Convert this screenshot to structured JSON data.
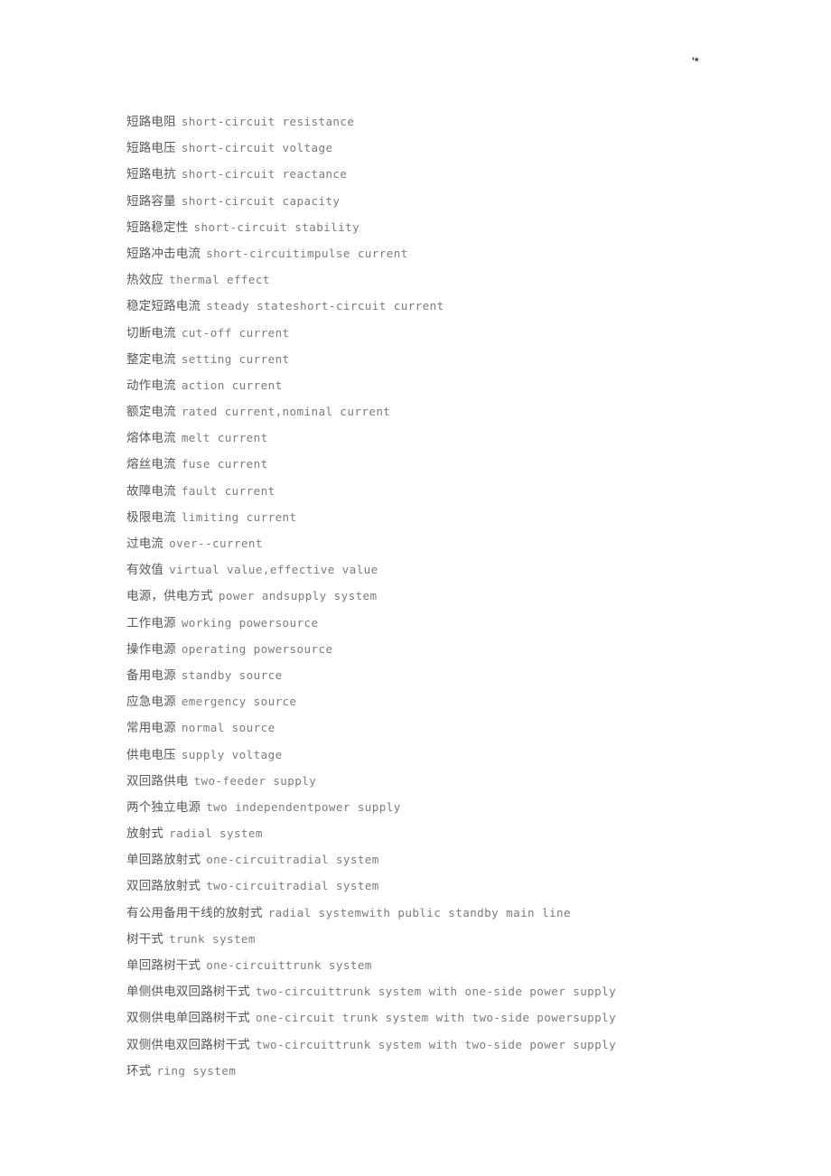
{
  "page": {
    "corner_mark": "'*"
  },
  "glossary": {
    "entries": [
      {
        "zh": "短路电阻",
        "en": "short-circuit resistance"
      },
      {
        "zh": "短路电压",
        "en": "short-circuit voltage"
      },
      {
        "zh": "短路电抗",
        "en": "short-circuit reactance"
      },
      {
        "zh": "短路容量",
        "en": "short-circuit capacity"
      },
      {
        "zh": "短路稳定性",
        "en": "short-circuit stability"
      },
      {
        "zh": "短路冲击电流",
        "en": "short-circuitimpulse current"
      },
      {
        "zh": "热效应",
        "en": "thermal effect"
      },
      {
        "zh": "稳定短路电流",
        "en": "steady stateshort-circuit current"
      },
      {
        "zh": "切断电流",
        "en": "cut-off current"
      },
      {
        "zh": "整定电流",
        "en": "setting current"
      },
      {
        "zh": "动作电流",
        "en": "action current"
      },
      {
        "zh": "额定电流",
        "en": "rated current,nominal current"
      },
      {
        "zh": "熔体电流",
        "en": "melt current"
      },
      {
        "zh": "熔丝电流",
        "en": "fuse current"
      },
      {
        "zh": "故障电流",
        "en": "fault current"
      },
      {
        "zh": "极限电流",
        "en": "limiting current"
      },
      {
        "zh": "过电流",
        "en": "over--current"
      },
      {
        "zh": "有效值",
        "en": "virtual value,effective value"
      },
      {
        "zh": "电源，供电方式",
        "en": "power andsupply system"
      },
      {
        "zh": "工作电源",
        "en": "working powersource"
      },
      {
        "zh": "操作电源",
        "en": "operating powersource"
      },
      {
        "zh": "备用电源",
        "en": "standby source"
      },
      {
        "zh": "应急电源",
        "en": "emergency source"
      },
      {
        "zh": "常用电源",
        "en": "normal source"
      },
      {
        "zh": "供电电压",
        "en": "supply voltage"
      },
      {
        "zh": "双回路供电",
        "en": "two-feeder supply"
      },
      {
        "zh": "两个独立电源",
        "en": "two independentpower supply"
      },
      {
        "zh": "放射式",
        "en": "radial system"
      },
      {
        "zh": "单回路放射式",
        "en": "one-circuitradial system"
      },
      {
        "zh": "双回路放射式",
        "en": "two-circuitradial system"
      },
      {
        "zh": "有公用备用干线的放射式",
        "en": "radial systemwith public standby main line"
      },
      {
        "zh": "树干式",
        "en": "trunk system"
      },
      {
        "zh": "单回路树干式",
        "en": "one-circuittrunk system"
      },
      {
        "zh": "单侧供电双回路树干式",
        "en": "two-circuittrunk system with one-side power supply"
      },
      {
        "zh": "双侧供电单回路树干式",
        "en": "one-circuit trunk system with two-side powersupply"
      },
      {
        "zh": "双侧供电双回路树干式",
        "en": "two-circuittrunk system with two-side power supply"
      },
      {
        "zh": "环式",
        "en": "ring system"
      }
    ]
  }
}
